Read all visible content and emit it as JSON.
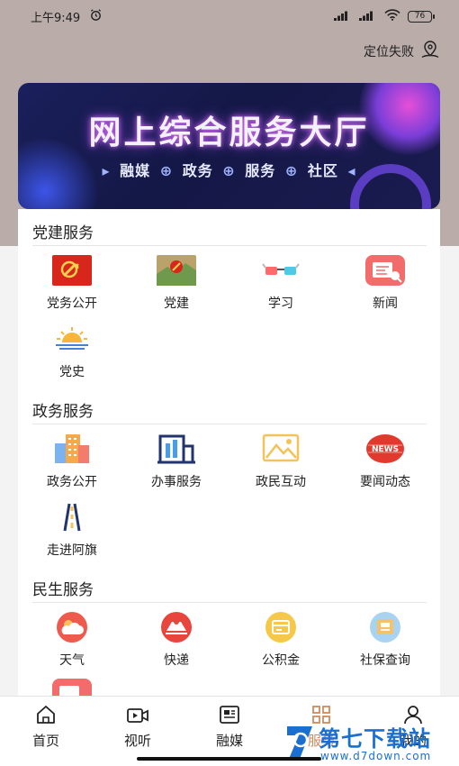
{
  "status_bar": {
    "time": "上午9:49",
    "battery": "76"
  },
  "location": {
    "label": "定位失败"
  },
  "banner": {
    "title": "网上综合服务大厅",
    "sub_items": [
      "融媒",
      "政务",
      "服务",
      "社区"
    ]
  },
  "sections": [
    {
      "title": "党建服务",
      "items": [
        {
          "label": "党务公开",
          "icon": "party-flag-icon"
        },
        {
          "label": "党建",
          "icon": "party-emblem-icon"
        },
        {
          "label": "学习",
          "icon": "glasses-icon"
        },
        {
          "label": "新闻",
          "icon": "news-icon"
        },
        {
          "label": "党史",
          "icon": "sunrise-icon"
        }
      ]
    },
    {
      "title": "政务服务",
      "items": [
        {
          "label": "政务公开",
          "icon": "buildings-icon"
        },
        {
          "label": "办事服务",
          "icon": "office-building-icon"
        },
        {
          "label": "政民互动",
          "icon": "mountain-icon"
        },
        {
          "label": "要闻动态",
          "icon": "news-badge-icon"
        },
        {
          "label": "走进阿旗",
          "icon": "road-icon"
        }
      ]
    },
    {
      "title": "民生服务",
      "items": [
        {
          "label": "天气",
          "icon": "weather-icon"
        },
        {
          "label": "快递",
          "icon": "delivery-icon"
        },
        {
          "label": "公积金",
          "icon": "fund-icon"
        },
        {
          "label": "社保查询",
          "icon": "social-security-icon"
        }
      ]
    }
  ],
  "tabbar": {
    "items": [
      {
        "label": "首页",
        "icon": "home-icon"
      },
      {
        "label": "视听",
        "icon": "video-icon"
      },
      {
        "label": "融媒",
        "icon": "media-icon"
      },
      {
        "label": "服务",
        "icon": "grid-icon"
      },
      {
        "label": "我的",
        "icon": "user-icon"
      }
    ]
  },
  "watermark": {
    "text": "第七下载站",
    "url": "www.d7down.com"
  },
  "colors": {
    "accent_red": "#e8453c",
    "banner_bg": "#161a4e",
    "watermark_blue": "#1b6fd1"
  }
}
